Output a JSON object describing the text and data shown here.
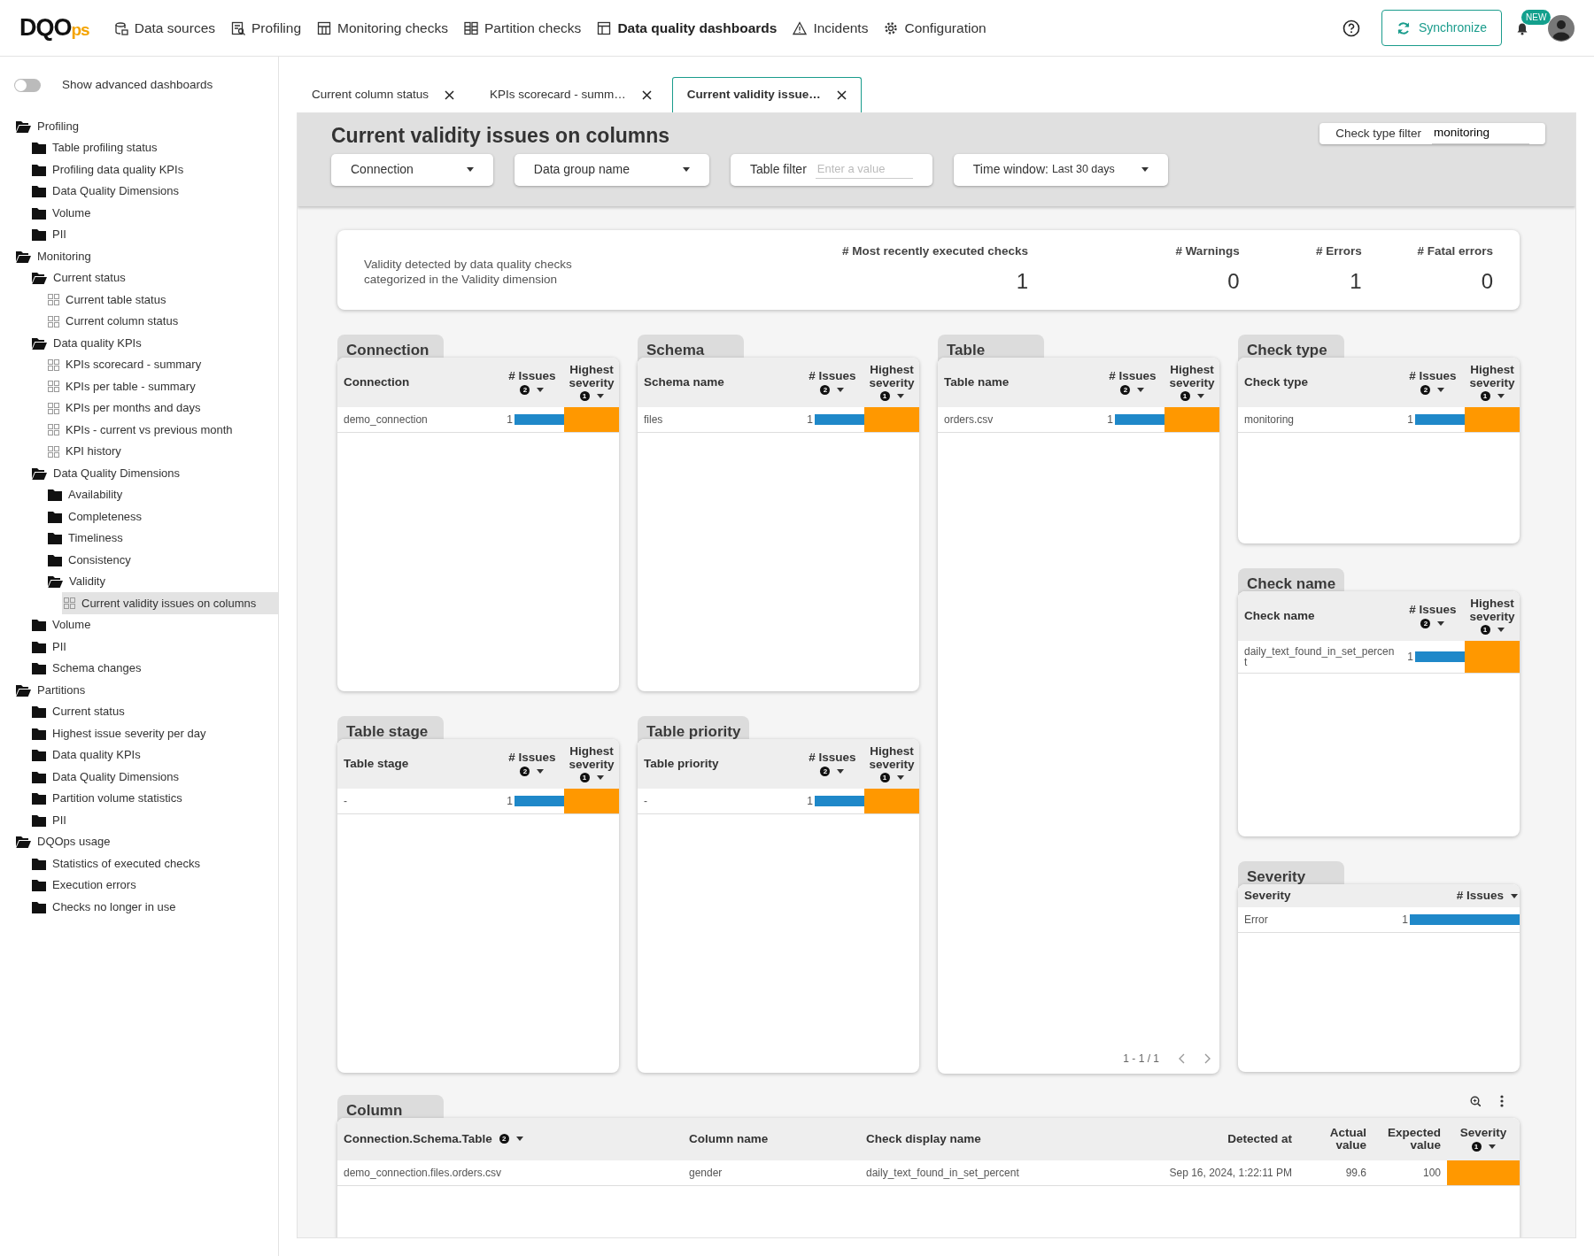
{
  "navbar": {
    "logo": "DQOps",
    "items": [
      {
        "label": "Data sources",
        "kind": "sources",
        "selected": false
      },
      {
        "label": "Profiling",
        "kind": "profiling",
        "selected": false
      },
      {
        "label": "Monitoring checks",
        "kind": "monitoring",
        "selected": false
      },
      {
        "label": "Partition checks",
        "kind": "partition",
        "selected": false
      },
      {
        "label": "Data quality dashboards",
        "kind": "dashboards",
        "selected": true
      },
      {
        "label": "Incidents",
        "kind": "incidents",
        "selected": false
      },
      {
        "label": "Configuration",
        "kind": "configuration",
        "selected": false
      }
    ],
    "sync_button": "Synchronize",
    "notification_badge": "NEW"
  },
  "sidebar": {
    "advanced_toggle": {
      "label": "Show advanced dashboards",
      "on": false
    },
    "tree": [
      {
        "label": "Profiling",
        "kind": "folder",
        "expanded": true,
        "selected": false,
        "children": [
          {
            "label": "Table profiling status",
            "kind": "folder",
            "expanded": false,
            "selected": false
          },
          {
            "label": "Profiling data quality KPIs",
            "kind": "folder",
            "expanded": false,
            "selected": false
          },
          {
            "label": "Data Quality Dimensions",
            "kind": "folder",
            "expanded": false,
            "selected": false
          },
          {
            "label": "Volume",
            "kind": "folder",
            "expanded": false,
            "selected": false
          },
          {
            "label": "PII",
            "kind": "folder",
            "expanded": false,
            "selected": false
          }
        ]
      },
      {
        "label": "Monitoring",
        "kind": "folder",
        "expanded": true,
        "selected": false,
        "children": [
          {
            "label": "Current status",
            "kind": "folder",
            "expanded": true,
            "selected": false,
            "children": [
              {
                "label": "Current table status",
                "kind": "dashboard",
                "selected": false
              },
              {
                "label": "Current column status",
                "kind": "dashboard",
                "selected": false
              }
            ]
          },
          {
            "label": "Data quality KPIs",
            "kind": "folder",
            "expanded": true,
            "selected": false,
            "children": [
              {
                "label": "KPIs scorecard - summary",
                "kind": "dashboard",
                "selected": false
              },
              {
                "label": "KPIs per table - summary",
                "kind": "dashboard",
                "selected": false
              },
              {
                "label": "KPIs per months and days",
                "kind": "dashboard",
                "selected": false
              },
              {
                "label": "KPIs - current vs previous month",
                "kind": "dashboard",
                "selected": false
              },
              {
                "label": "KPI history",
                "kind": "dashboard",
                "selected": false
              }
            ]
          },
          {
            "label": "Data Quality Dimensions",
            "kind": "folder",
            "expanded": true,
            "selected": false,
            "children": [
              {
                "label": "Availability",
                "kind": "folder",
                "expanded": false,
                "selected": false
              },
              {
                "label": "Completeness",
                "kind": "folder",
                "expanded": false,
                "selected": false
              },
              {
                "label": "Timeliness",
                "kind": "folder",
                "expanded": false,
                "selected": false
              },
              {
                "label": "Consistency",
                "kind": "folder",
                "expanded": false,
                "selected": false
              },
              {
                "label": "Validity",
                "kind": "folder",
                "expanded": true,
                "selected": false,
                "children": [
                  {
                    "label": "Current validity issues on columns",
                    "kind": "dashboard",
                    "selected": true
                  }
                ]
              }
            ]
          },
          {
            "label": "Volume",
            "kind": "folder",
            "expanded": false,
            "selected": false
          },
          {
            "label": "PII",
            "kind": "folder",
            "expanded": false,
            "selected": false
          },
          {
            "label": "Schema changes",
            "kind": "folder",
            "expanded": false,
            "selected": false
          }
        ]
      },
      {
        "label": "Partitions",
        "kind": "folder",
        "expanded": true,
        "selected": false,
        "children": [
          {
            "label": "Current status",
            "kind": "folder",
            "expanded": false,
            "selected": false
          },
          {
            "label": "Highest issue severity per day",
            "kind": "folder",
            "expanded": false,
            "selected": false
          },
          {
            "label": "Data quality KPIs",
            "kind": "folder",
            "expanded": false,
            "selected": false
          },
          {
            "label": "Data Quality Dimensions",
            "kind": "folder",
            "expanded": false,
            "selected": false
          },
          {
            "label": "Partition volume statistics",
            "kind": "folder",
            "expanded": false,
            "selected": false
          },
          {
            "label": "PII",
            "kind": "folder",
            "expanded": false,
            "selected": false
          }
        ]
      },
      {
        "label": "DQOps usage",
        "kind": "folder",
        "expanded": true,
        "selected": false,
        "children": [
          {
            "label": "Statistics of executed checks",
            "kind": "folder",
            "expanded": false,
            "selected": false
          },
          {
            "label": "Execution errors",
            "kind": "folder",
            "expanded": false,
            "selected": false
          },
          {
            "label": "Checks no longer in use",
            "kind": "folder",
            "expanded": false,
            "selected": false
          }
        ]
      }
    ]
  },
  "tabs": [
    {
      "label": "Current column status",
      "selected": false
    },
    {
      "label": "KPIs scorecard - summ…",
      "selected": false
    },
    {
      "label": "Current validity issue…",
      "selected": true
    }
  ],
  "dashboard": {
    "title": "Current validity issues on columns",
    "check_type_filter": {
      "label": "Check type filter",
      "value": "monitoring"
    },
    "filters": [
      {
        "kind": "dropdown",
        "label": "Connection"
      },
      {
        "kind": "dropdown",
        "label": "Data group name"
      },
      {
        "kind": "input",
        "label": "Table filter",
        "placeholder": "Enter a value"
      },
      {
        "kind": "dropdown",
        "label": "Time window:",
        "value": "Last 30 days"
      }
    ]
  },
  "summary": {
    "description": "Validity detected by data quality checks categorized in the Validity dimension",
    "metrics": [
      {
        "label": "# Most recently executed checks",
        "value": "1"
      },
      {
        "label": "# Warnings",
        "value": "0"
      },
      {
        "label": "# Errors",
        "value": "1"
      },
      {
        "label": "# Fatal errors",
        "value": "0"
      }
    ]
  },
  "panels": [
    {
      "title": "Connection",
      "columns": [
        {
          "label": "Connection",
          "caret": false
        },
        {
          "label": "# Issues",
          "sort_order": "2",
          "caret": true
        },
        {
          "label": "Highest severity",
          "sort_order": "1",
          "caret": true
        }
      ],
      "rows": [
        {
          "name": "demo_connection",
          "issues": "1",
          "level": 1,
          "color": "#ff9800"
        }
      ]
    },
    {
      "title": "Schema",
      "columns": [
        {
          "label": "Schema name",
          "caret": false
        },
        {
          "label": "# Issues",
          "sort_order": "2",
          "caret": true
        },
        {
          "label": "Highest severity",
          "sort_order": "1",
          "caret": true
        }
      ],
      "rows": [
        {
          "name": "files",
          "issues": "1",
          "level": 1,
          "color": "#ff9800"
        }
      ]
    },
    {
      "title": "Table",
      "columns": [
        {
          "label": "Table name",
          "caret": false
        },
        {
          "label": "# Issues",
          "sort_order": "2",
          "caret": true
        },
        {
          "label": "Highest severity",
          "sort_order": "1",
          "caret": true
        }
      ],
      "rows": [
        {
          "name": "orders.csv",
          "issues": "1",
          "level": 1,
          "color": "#ff9800"
        }
      ],
      "pagination": "1 - 1 / 1"
    },
    {
      "title": "Check type",
      "columns": [
        {
          "label": "Check type",
          "caret": false
        },
        {
          "label": "# Issues",
          "sort_order": "2",
          "caret": true
        },
        {
          "label": "Highest severity",
          "sort_order": "1",
          "caret": true
        }
      ],
      "rows": [
        {
          "name": "monitoring",
          "issues": "1",
          "level": 1,
          "color": "#ff9800"
        }
      ]
    },
    {
      "title": "Check name",
      "columns": [
        {
          "label": "Check name",
          "caret": false
        },
        {
          "label": "# Issues",
          "sort_order": "2",
          "caret": true
        },
        {
          "label": "Highest severity",
          "sort_order": "1",
          "caret": true
        }
      ],
      "rows": [
        {
          "name": "daily_text_found_in_set_percent",
          "issues": "1",
          "level": 1,
          "color": "#ff9800"
        }
      ]
    },
    {
      "title": "Table stage",
      "columns": [
        {
          "label": "Table stage",
          "caret": false
        },
        {
          "label": "# Issues",
          "sort_order": "2",
          "caret": true
        },
        {
          "label": "Highest severity",
          "sort_order": "1",
          "caret": true
        }
      ],
      "rows": [
        {
          "name": "-",
          "issues": "1",
          "level": 1,
          "color": "#ff9800"
        }
      ]
    },
    {
      "title": "Table priority",
      "columns": [
        {
          "label": "Table priority",
          "caret": false
        },
        {
          "label": "# Issues",
          "sort_order": "2",
          "caret": true
        },
        {
          "label": "Highest severity",
          "sort_order": "1",
          "caret": true
        }
      ],
      "rows": [
        {
          "name": "-",
          "issues": "1",
          "level": 1,
          "color": "#ff9800"
        }
      ]
    },
    {
      "title": "Severity",
      "columns": [
        {
          "label": "Severity",
          "caret": false
        },
        {
          "label": "# Issues",
          "caret": true
        }
      ],
      "rows": [
        {
          "name": "Error",
          "issues": "1",
          "level": 1
        }
      ]
    }
  ],
  "column_table": {
    "title": "Column",
    "columns": [
      {
        "label": "Connection.Schema.Table",
        "sort_order": "2",
        "caret": true
      },
      {
        "label": "Column name",
        "caret": false
      },
      {
        "label": "Check display name",
        "caret": false
      },
      {
        "label": "Detected at",
        "caret": false
      },
      {
        "label": "Actual value",
        "caret": false
      },
      {
        "label": "Expected value",
        "caret": false
      },
      {
        "label": "Severity",
        "sort_order": "1",
        "caret": true
      }
    ],
    "rows": [
      {
        "cells": [
          "demo_connection.files.orders.csv",
          "gender",
          "daily_text_found_in_set_percent",
          "Sep 16, 2024, 1:22:11 PM",
          "99.6",
          "100"
        ],
        "color": "#ff9800"
      }
    ]
  }
}
